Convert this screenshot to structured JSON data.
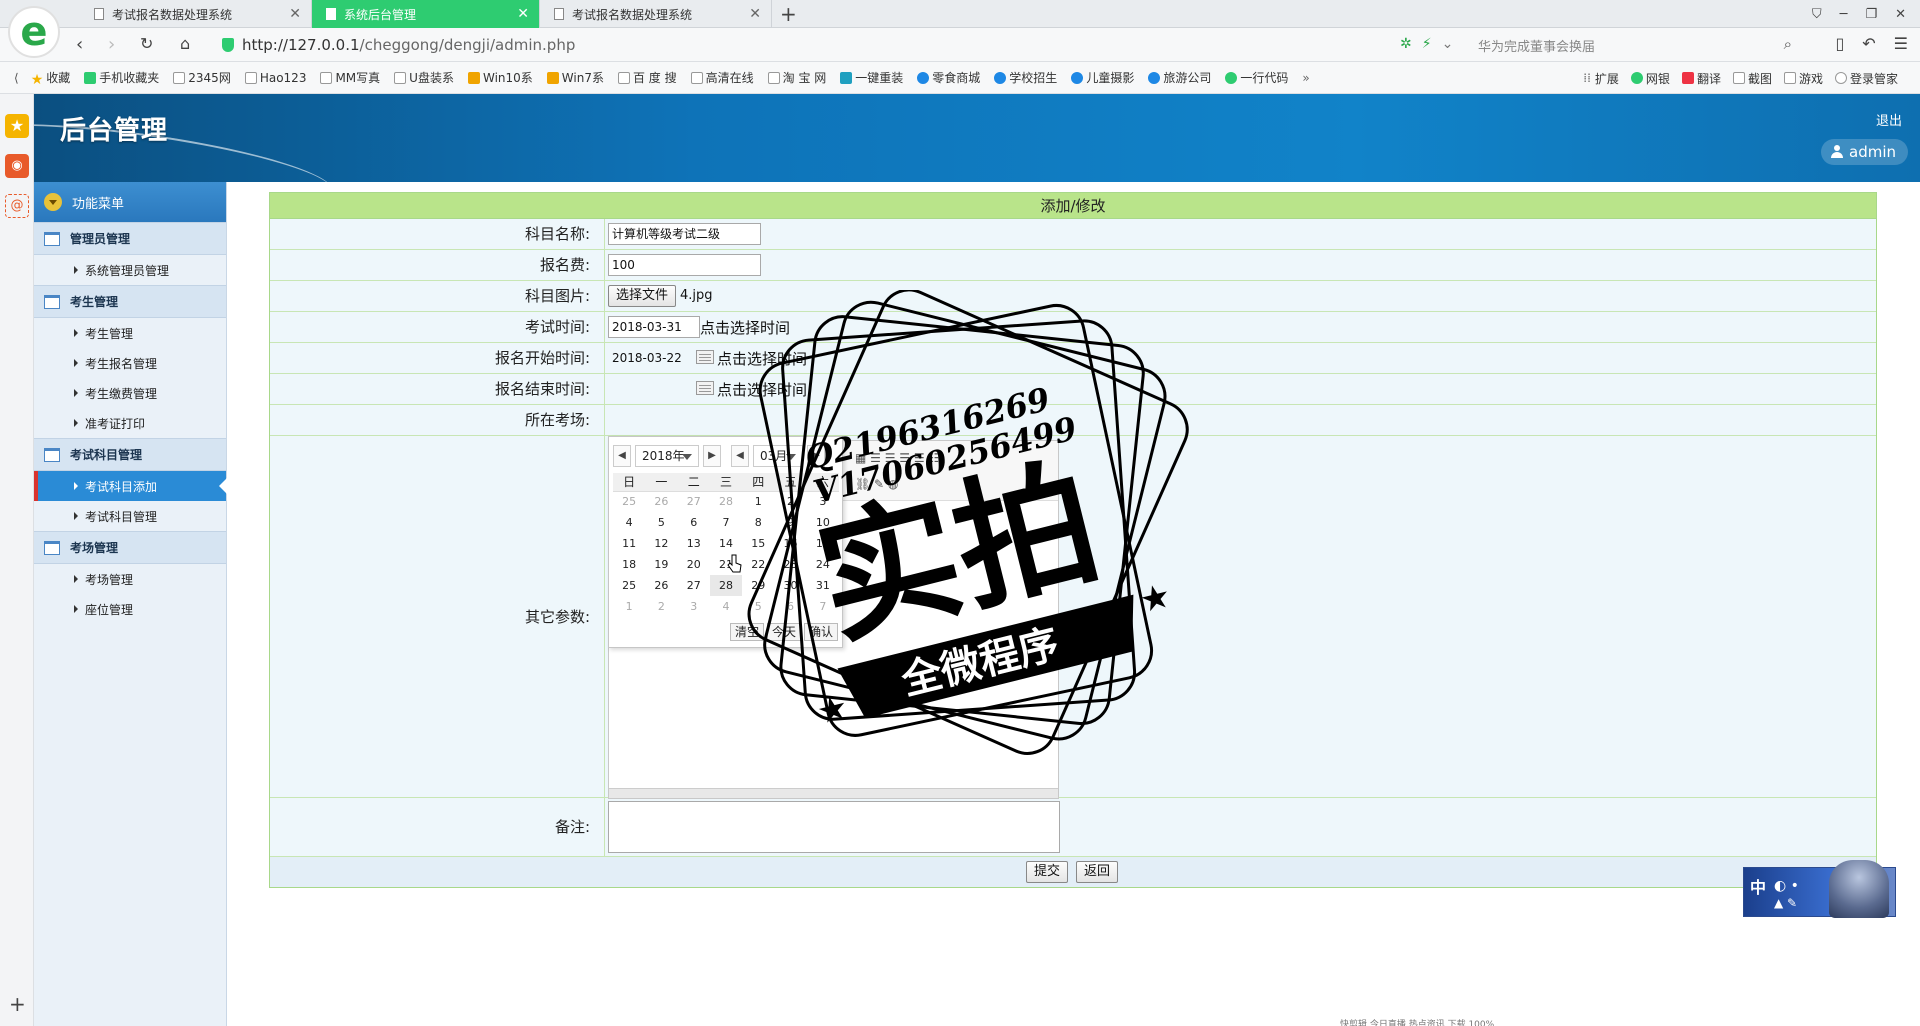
{
  "browser": {
    "tabs": [
      {
        "label": "考试报名数据处理系统",
        "active": false
      },
      {
        "label": "系统后台管理",
        "active": true
      },
      {
        "label": "考试报名数据处理系统",
        "active": false
      }
    ],
    "url_host": "http://127.0.0.1",
    "url_path": "/cheggong/dengji/admin.php",
    "search_placeholder": "华为完成董事会换届",
    "bookmarks": [
      "收藏",
      "手机收藏夹",
      "2345网",
      "Hao123",
      "MM写真",
      "U盘装系",
      "Win10系",
      "Win7系",
      "百 度 搜",
      "高清在线",
      "淘 宝 网",
      "一键重装",
      "零食商城",
      "学校招生",
      "儿童摄影",
      "旅游公司",
      "一行代码",
      "»"
    ],
    "bookmarks_right": [
      "扩展",
      "网银",
      "翻译",
      "截图",
      "游戏",
      "登录管家"
    ]
  },
  "header": {
    "title": "后台管理",
    "logout": "退出",
    "user": "admin"
  },
  "sidebar": {
    "menu_title": "功能菜单",
    "groups": [
      {
        "title": "管理员管理",
        "items": [
          {
            "label": "系统管理员管理",
            "active": false
          }
        ]
      },
      {
        "title": "考生管理",
        "items": [
          {
            "label": "考生管理",
            "active": false
          },
          {
            "label": "考生报名管理",
            "active": false
          },
          {
            "label": "考生缴费管理",
            "active": false
          },
          {
            "label": "准考证打印",
            "active": false
          }
        ]
      },
      {
        "title": "考试科目管理",
        "items": [
          {
            "label": "考试科目添加",
            "active": true
          },
          {
            "label": "考试科目管理",
            "active": false
          }
        ]
      },
      {
        "title": "考场管理",
        "items": [
          {
            "label": "考场管理",
            "active": false
          },
          {
            "label": "座位管理",
            "active": false
          }
        ]
      }
    ]
  },
  "form": {
    "title": "添加/修改",
    "subject_label": "科目名称:",
    "subject_value": "计算机等级考试二级",
    "fee_label": "报名费:",
    "fee_value": "100",
    "image_label": "科目图片:",
    "file_button": "选择文件",
    "file_name": "4.jpg",
    "exam_time_label": "考试时间:",
    "exam_time_value": "2018-03-31",
    "reg_start_label": "报名开始时间:",
    "reg_start_value": "2018-03-22",
    "reg_end_label": "报名结束时间:",
    "reg_end_value": "",
    "pick_hint": "点击选择时间",
    "venue_label": "所在考场:",
    "other_label": "其它参数:",
    "remark_label": "备注:",
    "submit": "提交",
    "back": "返回"
  },
  "datepicker": {
    "year": "2018年",
    "month": "03月",
    "weekdays": [
      "日",
      "一",
      "二",
      "三",
      "四",
      "五",
      "六"
    ],
    "weeks": [
      [
        "25",
        "26",
        "27",
        "28",
        "1",
        "2",
        "3"
      ],
      [
        "4",
        "5",
        "6",
        "7",
        "8",
        "9",
        "10"
      ],
      [
        "11",
        "12",
        "13",
        "14",
        "15",
        "16",
        "17"
      ],
      [
        "18",
        "19",
        "20",
        "21",
        "22",
        "23",
        "24"
      ],
      [
        "25",
        "26",
        "27",
        "28",
        "29",
        "30",
        "31"
      ],
      [
        "1",
        "2",
        "3",
        "4",
        "5",
        "6",
        "7"
      ]
    ],
    "clear": "清空",
    "today": "今天",
    "ok": "确认"
  },
  "watermark": {
    "line1": "Q2196316269",
    "line2": "V17060256499",
    "big": "实拍",
    "ribbon": "全微程序"
  },
  "widget": {
    "ime": "中"
  },
  "statusbar": "快剪辑   今日直播   热点资讯      下载      100%"
}
